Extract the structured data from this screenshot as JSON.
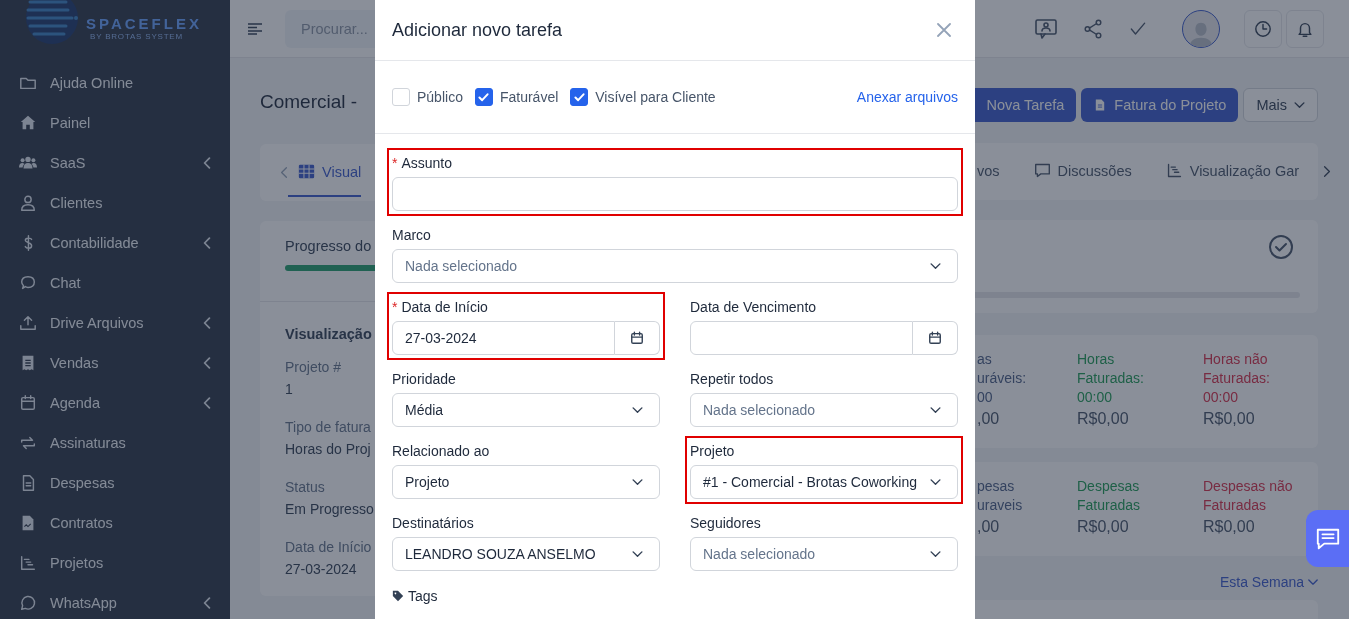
{
  "sidebar": {
    "logo": {
      "name": "SPACEFLEX",
      "tagline": "BY BROTAS SYSTEM"
    },
    "items": [
      {
        "label": "Ajuda Online",
        "expandable": false
      },
      {
        "label": "Painel",
        "expandable": false
      },
      {
        "label": "SaaS",
        "expandable": true
      },
      {
        "label": "Clientes",
        "expandable": false
      },
      {
        "label": "Contabilidade",
        "expandable": true
      },
      {
        "label": "Chat",
        "expandable": false
      },
      {
        "label": "Drive Arquivos",
        "expandable": true
      },
      {
        "label": "Vendas",
        "expandable": true
      },
      {
        "label": "Agenda",
        "expandable": true
      },
      {
        "label": "Assinaturas",
        "expandable": false
      },
      {
        "label": "Despesas",
        "expandable": false
      },
      {
        "label": "Contratos",
        "expandable": false
      },
      {
        "label": "Projetos",
        "expandable": false
      },
      {
        "label": "WhatsApp",
        "expandable": true
      }
    ]
  },
  "topbar": {
    "search": {
      "placeholder": "Procurar..."
    }
  },
  "page": {
    "title": "Comercial -",
    "actions": [
      {
        "label": "Nova Tarefa",
        "kind": "primary"
      },
      {
        "label": "Fatura do Projeto",
        "kind": "primary"
      },
      {
        "label": "Mais",
        "kind": "dropdown"
      }
    ],
    "tabs": [
      {
        "label": "Visual",
        "selected": true
      },
      {
        "label": "vos",
        "selected": false
      },
      {
        "label": "Discussões",
        "selected": false
      },
      {
        "label": "Visualização Gar",
        "selected": false
      }
    ],
    "progress": {
      "label": "Progresso do"
    },
    "details_title": "Visualização",
    "details": [
      {
        "label": "Projeto #",
        "value": "1"
      },
      {
        "label": "Tipo de fatura",
        "value": "Horas do Proj"
      },
      {
        "label": "Status",
        "value": "Em Progresso"
      },
      {
        "label": "Data de Início",
        "value": "27-03-2024"
      }
    ],
    "hours": [
      {
        "lines": [
          "as",
          "uráveis:"
        ],
        "time": "00",
        "amount": ",00",
        "kind": "billable"
      },
      {
        "lines": [
          "Horas",
          "Faturadas:"
        ],
        "time": "00:00",
        "amount": "R$0,00",
        "kind": "billed"
      },
      {
        "lines": [
          "Horas não",
          "Faturadas:"
        ],
        "time": "00:00",
        "amount": "R$0,00",
        "kind": "unbilled"
      }
    ],
    "expenses": [
      {
        "lines": [
          "pesas",
          "uraveis"
        ],
        "amount": ",00",
        "kind": "billable"
      },
      {
        "lines": [
          "Despesas",
          "Faturadas"
        ],
        "amount": "R$0,00",
        "kind": "billed"
      },
      {
        "lines": [
          "Despesas não",
          "Faturadas"
        ],
        "amount": "R$0,00",
        "kind": "unbilled"
      }
    ],
    "filter": "Esta Semana"
  },
  "modal": {
    "title": "Adicionar novo tarefa",
    "checkboxes": [
      {
        "label": "Público",
        "checked": false
      },
      {
        "label": "Faturável",
        "checked": true
      },
      {
        "label": "Visível para Cliente",
        "checked": true
      }
    ],
    "attach_link": "Anexar arquivos",
    "rows": [
      [
        {
          "label": "Assunto",
          "kind": "text",
          "required_mark": "*",
          "highlighted": true
        }
      ],
      [
        {
          "label": "Marco",
          "kind": "select",
          "placeholder": "Nada selecionado",
          "highlighted": false
        }
      ],
      [
        {
          "label": "Data de Início",
          "kind": "date",
          "value": "27-03-2024",
          "required_mark": "*",
          "highlighted": true
        },
        {
          "label": "Data de Vencimento",
          "kind": "date",
          "highlighted": false
        }
      ],
      [
        {
          "label": "Prioridade",
          "kind": "select",
          "value": "Média",
          "highlighted": false
        },
        {
          "label": "Repetir todos",
          "kind": "select",
          "placeholder": "Nada selecionado",
          "highlighted": false
        }
      ],
      [
        {
          "label": "Relacionado ao",
          "kind": "select",
          "value": "Projeto",
          "highlighted": false
        },
        {
          "label": "Projeto",
          "kind": "select",
          "value": "#1 - Comercial - Brotas Coworking",
          "highlighted": true
        }
      ],
      [
        {
          "label": "Destinatários",
          "kind": "select",
          "value": "LEANDRO SOUZA ANSELMO",
          "highlighted": false
        },
        {
          "label": "Seguidores",
          "kind": "select",
          "placeholder": "Nada selecionado",
          "highlighted": false
        }
      ]
    ],
    "tags_label": "Tags"
  }
}
